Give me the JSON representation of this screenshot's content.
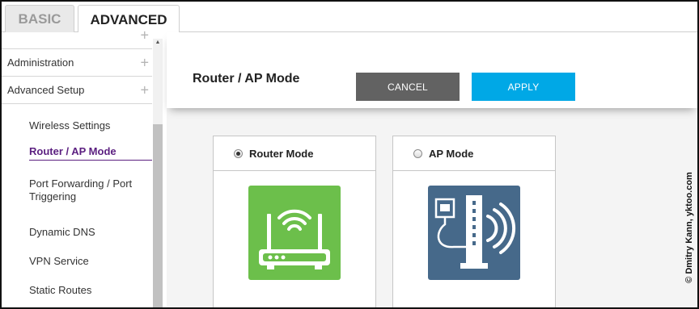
{
  "tabs": {
    "basic": "BASIC",
    "advanced": "ADVANCED"
  },
  "sidebar": {
    "items": [
      {
        "label": "Administration"
      },
      {
        "label": "Advanced Setup"
      }
    ],
    "plus_glyph": "+",
    "subitems": [
      {
        "label": "Wireless Settings"
      },
      {
        "label": "Router / AP Mode"
      },
      {
        "label": "Port Forwarding / Port Triggering"
      },
      {
        "label": "Dynamic DNS"
      },
      {
        "label": "VPN Service"
      },
      {
        "label": "Static Routes"
      }
    ],
    "active_subitem": "Router / AP Mode"
  },
  "main": {
    "title": "Router / AP Mode",
    "cancel_label": "CANCEL",
    "apply_label": "APPLY",
    "options": [
      {
        "label": "Router Mode",
        "selected": true,
        "icon": "wifi-router-icon",
        "tile_color": "#6cbf4b"
      },
      {
        "label": "AP Mode",
        "selected": false,
        "icon": "access-point-icon",
        "tile_color": "#46698a"
      }
    ]
  },
  "watermark": "© Dmitry Kann, yktoo.com",
  "colors": {
    "accent": "#00a8e6",
    "active_item": "#5b1f80",
    "cancel": "#626262"
  }
}
